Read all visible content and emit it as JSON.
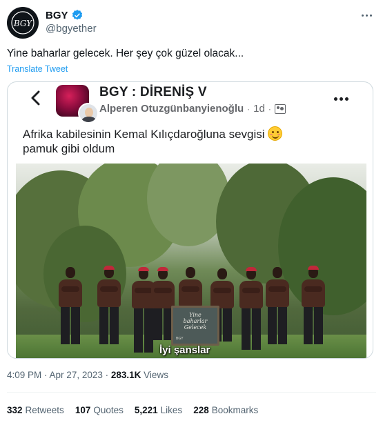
{
  "tweet": {
    "display_name": "BGY",
    "handle": "@bgyether",
    "text": "Yine baharlar gelecek. Her şey çok güzel olacak...",
    "translate_label": "Translate Tweet",
    "time": "4:09 PM",
    "date": "Apr 27, 2023",
    "views_count": "283.1K",
    "views_label": "Views",
    "avatar_logo": "BGY",
    "icons": {
      "verified": "verified-badge-icon",
      "more": "more-options-icon"
    },
    "colors": {
      "accent": "#1d9bf0",
      "muted": "#536471"
    }
  },
  "stats": {
    "retweets_count": "332",
    "retweets_label": "Retweets",
    "quotes_count": "107",
    "quotes_label": "Quotes",
    "likes_count": "5,221",
    "likes_label": "Likes",
    "bookmarks_count": "228",
    "bookmarks_label": "Bookmarks"
  },
  "screenshot": {
    "group_name": "BGY : DİRENİŞ V",
    "author": "Alperen Otuzgünbanyienoğlu",
    "separator": "·",
    "age": "1d",
    "post_text": "Afrika kabilesinin Kemal Kılıçdaroğluna sevgisi",
    "post_text_2": "pamuk gibi oldum",
    "board_line_1": "Yine",
    "board_line_2": "baharlar",
    "board_line_3": "Gelecek",
    "board_sign": "BGY",
    "subtitle": "İyi şanslar"
  }
}
